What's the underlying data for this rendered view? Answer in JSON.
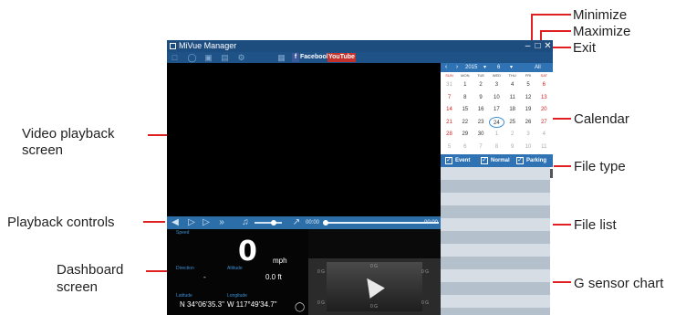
{
  "annotations": {
    "minimize": "Minimize",
    "maximize": "Maximize",
    "exit": "Exit",
    "calendar": "Calendar",
    "file_type": "File type",
    "file_list": "File list",
    "g_sensor_chart": "G sensor chart",
    "video_playback_line1": "Video playback",
    "video_playback_line2": "screen",
    "playback_controls": "Playback controls",
    "dashboard_line1": "Dashboard",
    "dashboard_line2": "screen"
  },
  "app": {
    "title": "MiVue Manager",
    "toolbar": {
      "facebook": "Facebook",
      "youtube": "YouTube"
    }
  },
  "controls": {
    "time_start": "00:00",
    "time_end": "00:00",
    "volume_fraction": 0.7,
    "progress_fraction": 0.0
  },
  "dashboard": {
    "speed_label": "Speed",
    "speed_value": "0",
    "speed_unit": "mph",
    "direction_label": "Direction",
    "direction_value": "-",
    "altitude_label": "Altitude",
    "altitude_value": "0.0  ft",
    "latitude_label": "Latitude",
    "latitude_value": "N 34°06'35.3\"",
    "longitude_label": "Longitude",
    "longitude_value": "W 117°49'34.7\""
  },
  "gsensor": {
    "labels": [
      "0 G",
      "0 G",
      "0 G",
      "0 G",
      "0 G",
      "0 G"
    ]
  },
  "calendar": {
    "year": "2015",
    "month": "6",
    "all_label": "All",
    "weekdays": [
      "SUN",
      "MON",
      "TUE",
      "WED",
      "THU",
      "FRI",
      "SAT"
    ],
    "weeks": [
      [
        "31",
        "1",
        "2",
        "3",
        "4",
        "5",
        "6"
      ],
      [
        "7",
        "8",
        "9",
        "10",
        "11",
        "12",
        "13"
      ],
      [
        "14",
        "15",
        "16",
        "17",
        "18",
        "19",
        "20"
      ],
      [
        "21",
        "22",
        "23",
        "24",
        "25",
        "26",
        "27"
      ],
      [
        "28",
        "29",
        "30",
        "1",
        "2",
        "3",
        "4"
      ],
      [
        "5",
        "6",
        "7",
        "8",
        "9",
        "10",
        "11"
      ]
    ],
    "selected_day": "24"
  },
  "file_type": {
    "options": [
      {
        "label": "Event",
        "checked": true
      },
      {
        "label": "Normal",
        "checked": true
      },
      {
        "label": "Parking",
        "checked": true
      }
    ]
  },
  "colors": {
    "accent": "#2f73b4",
    "annotation_line": "#e02020",
    "weekend": "#d42020"
  }
}
